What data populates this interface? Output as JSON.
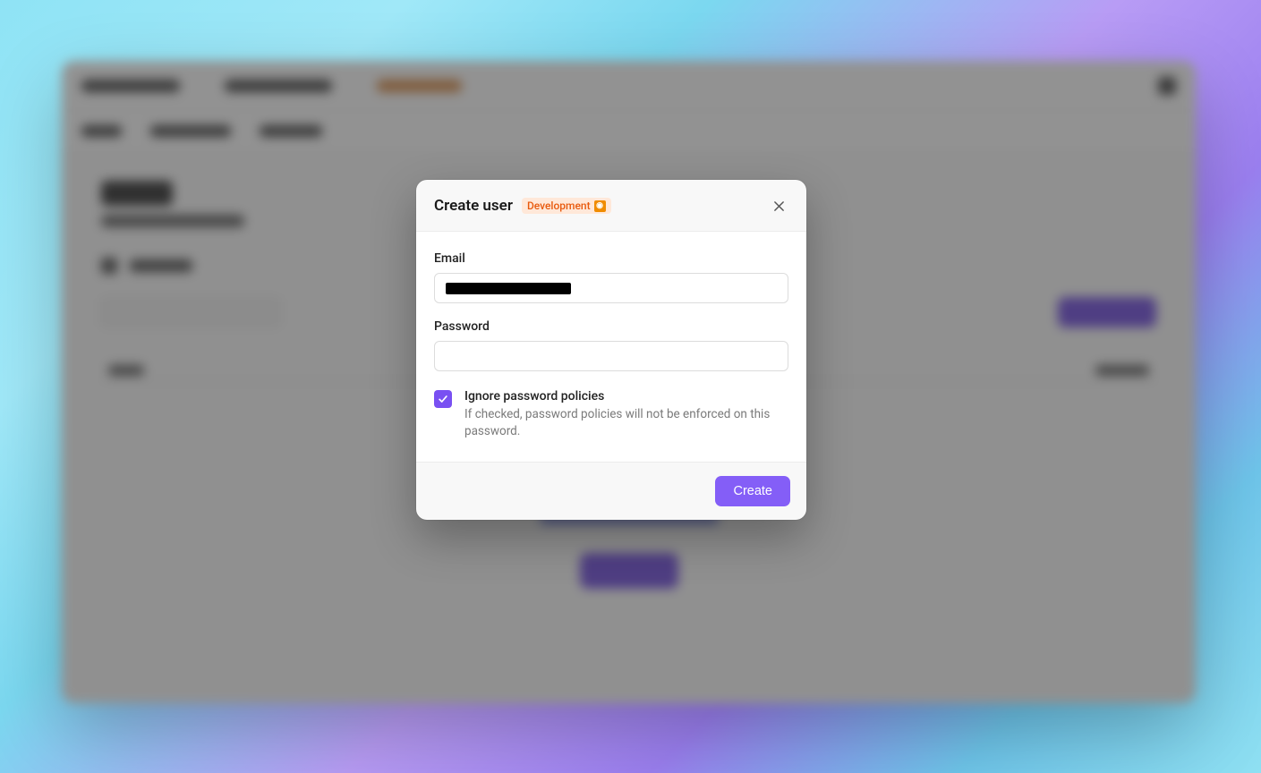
{
  "modal": {
    "title": "Create user",
    "env_badge": "Development",
    "close_label": "Close",
    "fields": {
      "email": {
        "label": "Email",
        "value": "",
        "masked": true
      },
      "password": {
        "label": "Password",
        "value": ""
      }
    },
    "ignore_policies": {
      "checked": true,
      "title": "Ignore password policies",
      "description": "If checked, password policies will not be enforced on this password."
    },
    "submit_label": "Create"
  },
  "colors": {
    "primary": "#845ef7",
    "badge_bg": "#ffe8d9",
    "badge_fg": "#e8590c"
  }
}
